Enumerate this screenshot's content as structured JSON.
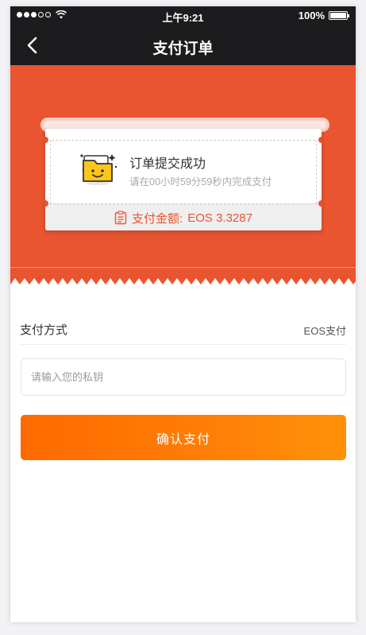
{
  "status_bar": {
    "time": "上午9:21",
    "battery": "100%",
    "battery_level": 1.0,
    "signal_dots": [
      true,
      true,
      true,
      false,
      false
    ]
  },
  "nav": {
    "title": "支付订单",
    "back_icon": "chevron-left-icon"
  },
  "order": {
    "success_title": "订单提交成功",
    "countdown_text": "请在00小时59分59秒内完成支付",
    "amount_label": "支付金额:",
    "amount_value": "EOS 3.3287",
    "icon": "folder-smiley-icon",
    "amount_icon": "clipboard-icon"
  },
  "payment": {
    "method_label": "支付方式",
    "method_value": "EOS支付"
  },
  "private_key": {
    "placeholder": "请输入您的私钥",
    "value": ""
  },
  "confirm_button": {
    "label": "确认支付"
  },
  "colors": {
    "header": "#1c1c1e",
    "hero": "#e85530",
    "accent": "#ff6a00",
    "accent_end": "#ff9108"
  }
}
